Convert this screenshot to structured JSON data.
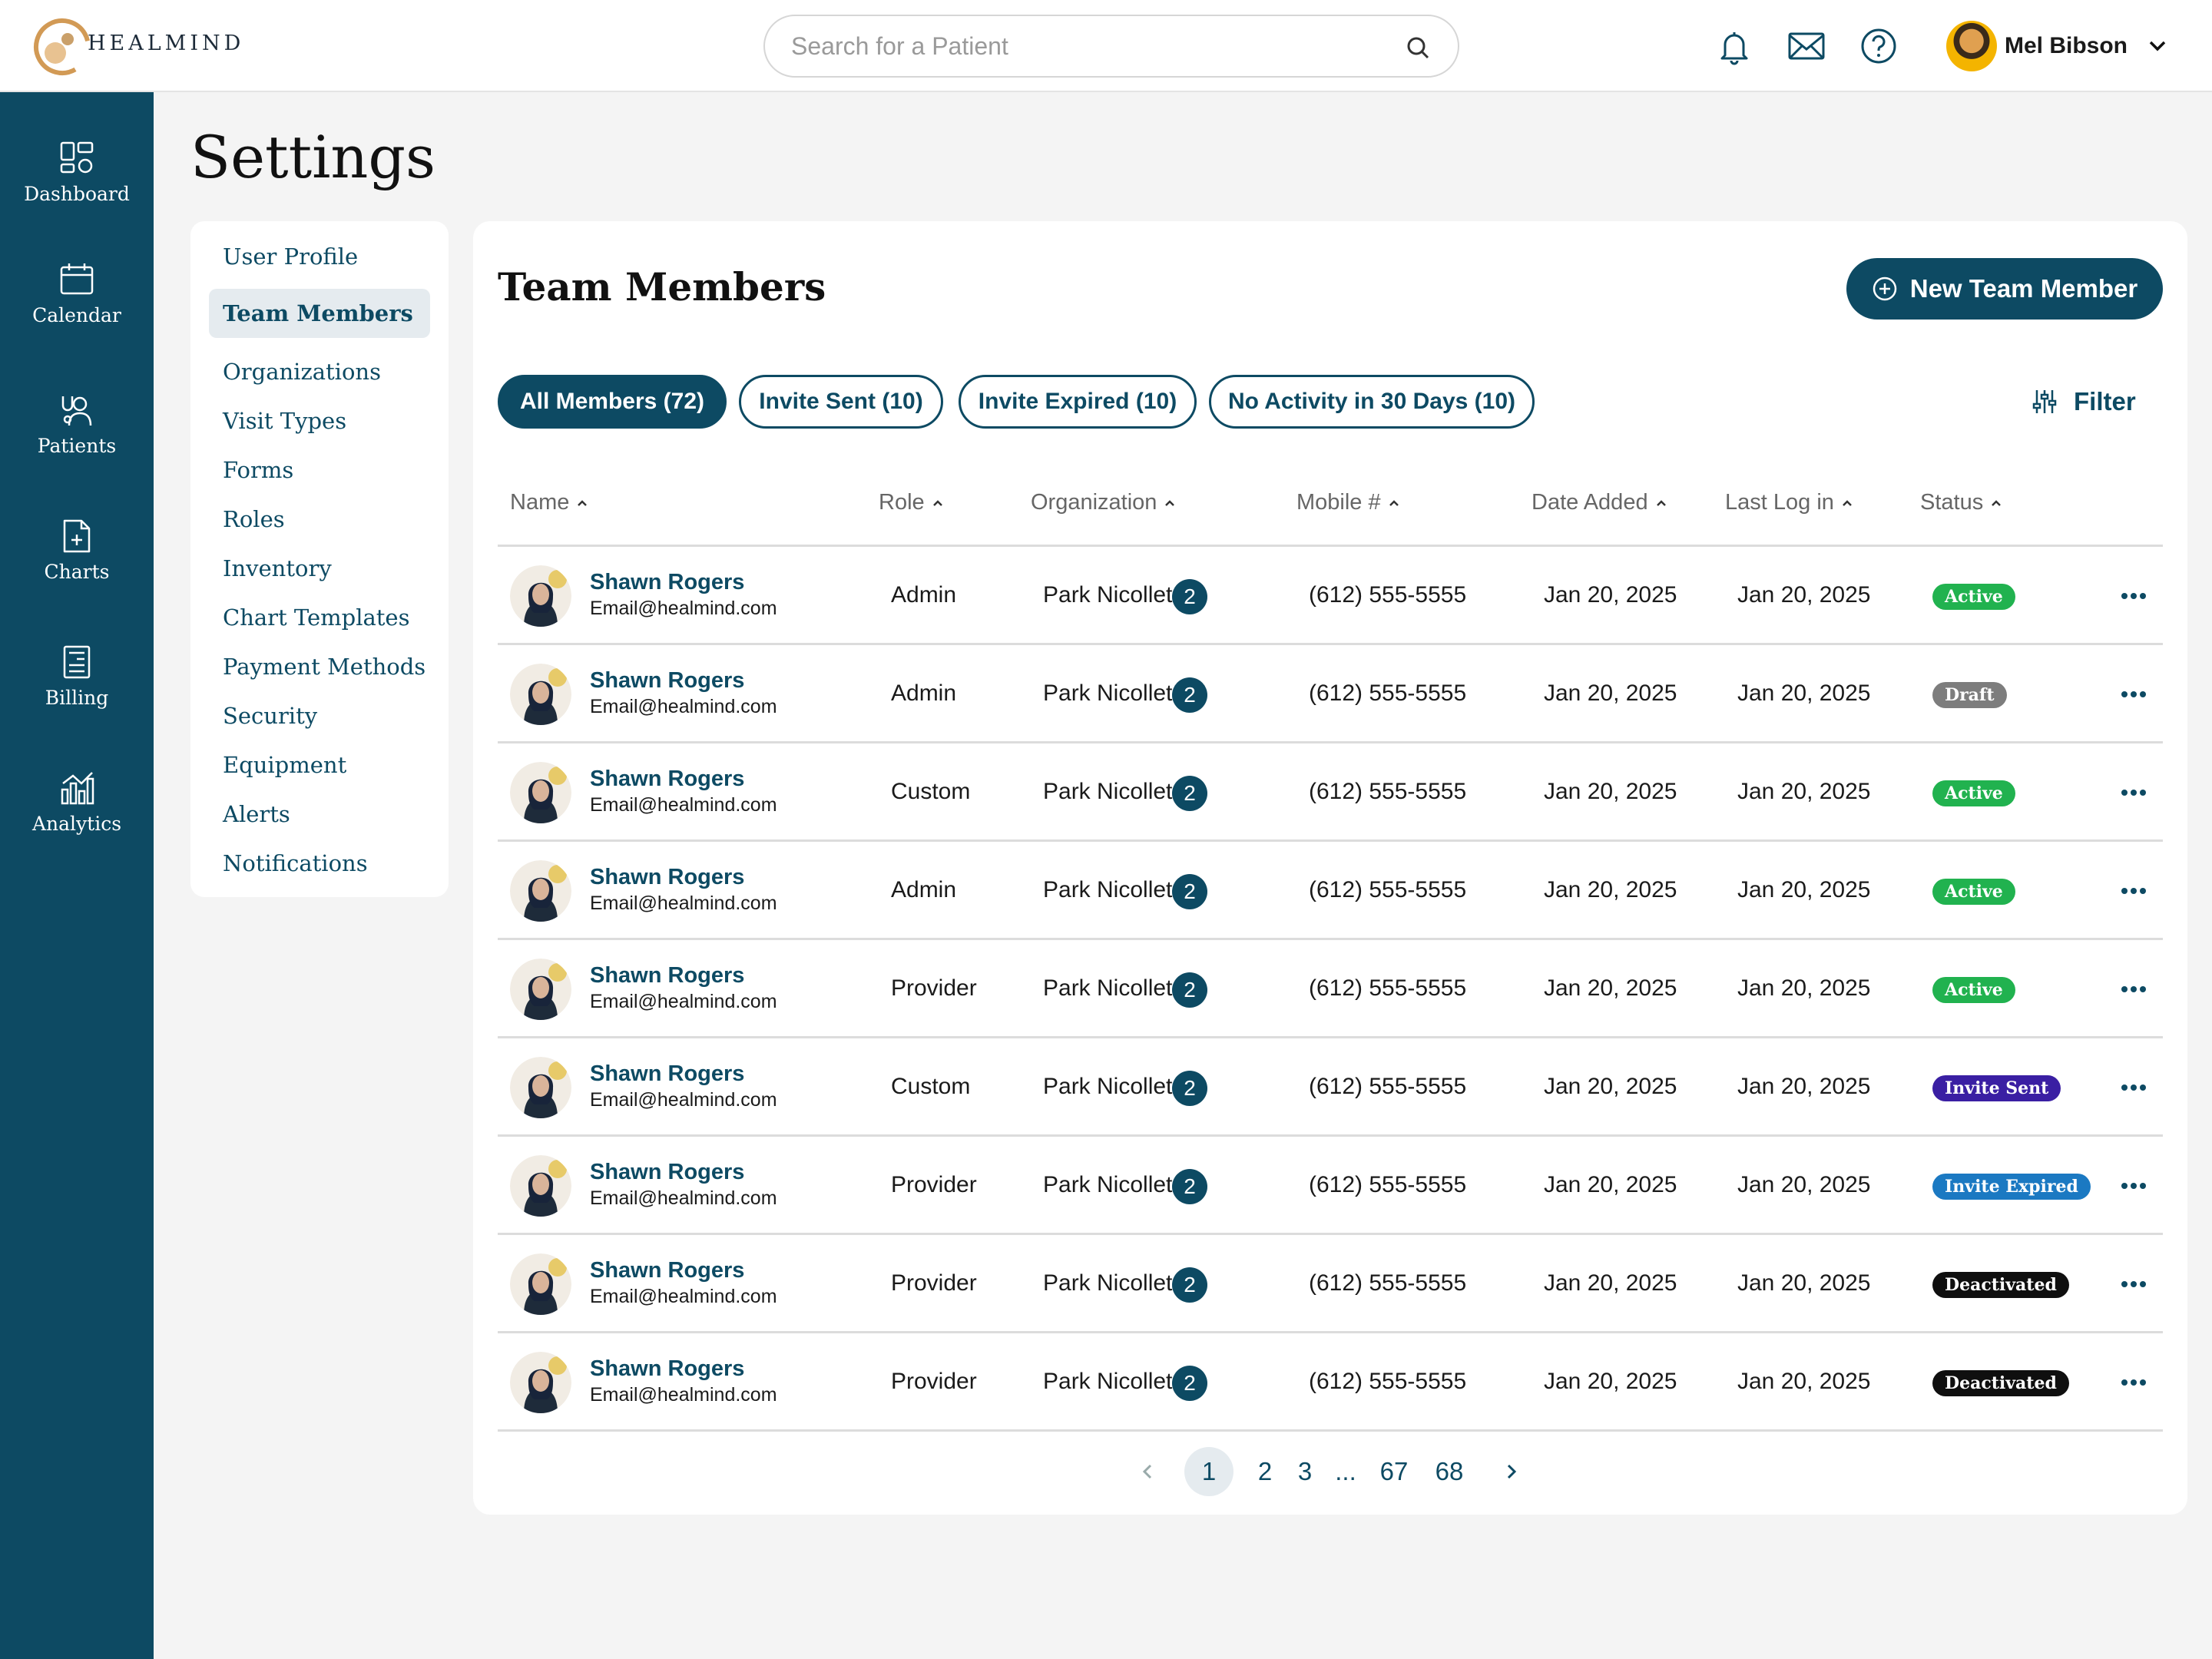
{
  "app": {
    "brand": "HEALMIND"
  },
  "search": {
    "placeholder": "Search for a Patient"
  },
  "user": {
    "name": "Mel Bibson"
  },
  "sidebar": {
    "items": [
      {
        "label": "Dashboard",
        "icon": "dashboard-icon"
      },
      {
        "label": "Calendar",
        "icon": "calendar-icon"
      },
      {
        "label": "Patients",
        "icon": "patients-icon"
      },
      {
        "label": "Charts",
        "icon": "charts-icon"
      },
      {
        "label": "Billing",
        "icon": "billing-icon"
      },
      {
        "label": "Analytics",
        "icon": "analytics-icon"
      }
    ]
  },
  "page": {
    "title": "Settings"
  },
  "settings_menu": {
    "items": [
      {
        "label": "User Profile"
      },
      {
        "label": "Team Members",
        "active": true
      },
      {
        "label": "Organizations"
      },
      {
        "label": "Visit Types"
      },
      {
        "label": "Forms"
      },
      {
        "label": "Roles"
      },
      {
        "label": "Inventory"
      },
      {
        "label": "Chart Templates"
      },
      {
        "label": "Payment Methods"
      },
      {
        "label": "Security"
      },
      {
        "label": "Equipment"
      },
      {
        "label": "Alerts"
      },
      {
        "label": "Notifications"
      }
    ]
  },
  "team": {
    "title": "Team Members",
    "new_button": "New Team Member",
    "filters": [
      {
        "label": "All Members (72)",
        "active": true
      },
      {
        "label": "Invite Sent (10)"
      },
      {
        "label": "Invite Expired (10)"
      },
      {
        "label": "No Activity in 30 Days (10)"
      }
    ],
    "filter_label": "Filter",
    "columns": [
      "Name",
      "Role",
      "Organization",
      "Mobile #",
      "Date Added",
      "Last Log in",
      "Status"
    ],
    "rows": [
      {
        "name": "Shawn Rogers",
        "email": "Email@healmind.com",
        "role": "Admin",
        "org": "Park Nicollet",
        "org_count": "2",
        "mobile": "(612) 555-5555",
        "added": "Jan 20, 2025",
        "last_login": "Jan 20, 2025",
        "status": "Active"
      },
      {
        "name": "Shawn Rogers",
        "email": "Email@healmind.com",
        "role": "Admin",
        "org": "Park Nicollet",
        "org_count": "2",
        "mobile": "(612) 555-5555",
        "added": "Jan 20, 2025",
        "last_login": "Jan 20, 2025",
        "status": "Draft"
      },
      {
        "name": "Shawn Rogers",
        "email": "Email@healmind.com",
        "role": "Custom",
        "org": "Park Nicollet",
        "org_count": "2",
        "mobile": "(612) 555-5555",
        "added": "Jan 20, 2025",
        "last_login": "Jan 20, 2025",
        "status": "Active"
      },
      {
        "name": "Shawn Rogers",
        "email": "Email@healmind.com",
        "role": "Admin",
        "org": "Park Nicollet",
        "org_count": "2",
        "mobile": "(612) 555-5555",
        "added": "Jan 20, 2025",
        "last_login": "Jan 20, 2025",
        "status": "Active"
      },
      {
        "name": "Shawn Rogers",
        "email": "Email@healmind.com",
        "role": "Provider",
        "org": "Park Nicollet",
        "org_count": "2",
        "mobile": "(612) 555-5555",
        "added": "Jan 20, 2025",
        "last_login": "Jan 20, 2025",
        "status": "Active"
      },
      {
        "name": "Shawn Rogers",
        "email": "Email@healmind.com",
        "role": "Custom",
        "org": "Park Nicollet",
        "org_count": "2",
        "mobile": "(612) 555-5555",
        "added": "Jan 20, 2025",
        "last_login": "Jan 20, 2025",
        "status": "Invite Sent"
      },
      {
        "name": "Shawn Rogers",
        "email": "Email@healmind.com",
        "role": "Provider",
        "org": "Park Nicollet",
        "org_count": "2",
        "mobile": "(612) 555-5555",
        "added": "Jan 20, 2025",
        "last_login": "Jan 20, 2025",
        "status": "Invite Expired"
      },
      {
        "name": "Shawn Rogers",
        "email": "Email@healmind.com",
        "role": "Provider",
        "org": "Park Nicollet",
        "org_count": "2",
        "mobile": "(612) 555-5555",
        "added": "Jan 20, 2025",
        "last_login": "Jan 20, 2025",
        "status": "Deactivated"
      },
      {
        "name": "Shawn Rogers",
        "email": "Email@healmind.com",
        "role": "Provider",
        "org": "Park Nicollet",
        "org_count": "2",
        "mobile": "(612) 555-5555",
        "added": "Jan 20, 2025",
        "last_login": "Jan 20, 2025",
        "status": "Deactivated"
      }
    ],
    "status_colors": {
      "Active": "#21b24f",
      "Draft": "#7d7d7d",
      "Invite Sent": "#3a1fa3",
      "Invite Expired": "#1b79c2",
      "Deactivated": "#0f0f0f"
    }
  },
  "pagination": {
    "pages": [
      "1",
      "2",
      "3",
      "...",
      "67",
      "68"
    ],
    "current": "1"
  },
  "colors": {
    "primary": "#0d4a63",
    "background": "#f4f4f4"
  }
}
